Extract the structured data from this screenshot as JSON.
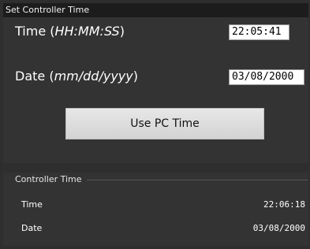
{
  "set_panel": {
    "title": "Set Controller Time",
    "time_label_prefix": "Time (",
    "time_label_format": "HH:MM:SS",
    "time_label_suffix": ")",
    "time_value": "22:05:41",
    "date_label_prefix": "Date (",
    "date_label_format": "mm/dd/yyyy",
    "date_label_suffix": ")",
    "date_value": "03/08/2000",
    "button_label": "Use PC Time"
  },
  "controller_panel": {
    "title": "Controller Time",
    "rows": [
      {
        "label": "Time",
        "value": "22:06:18"
      },
      {
        "label": "Date",
        "value": "03/08/2000"
      }
    ]
  }
}
